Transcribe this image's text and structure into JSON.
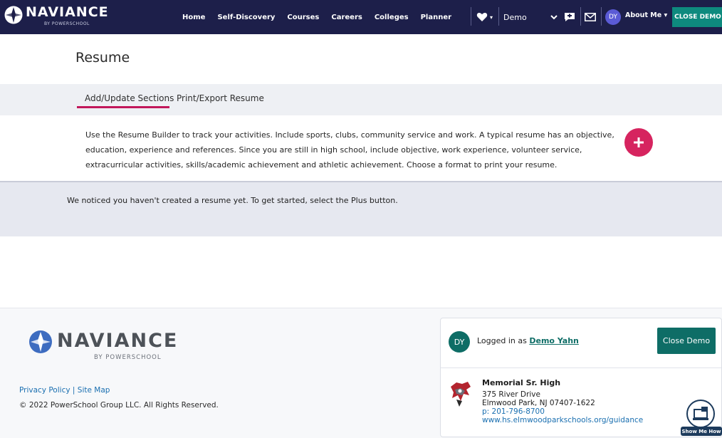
{
  "brand": {
    "name": "NAVIANCE",
    "sub": "BY POWERSCHOOL",
    "accent": "#1d1f4a",
    "pink": "#d6245f",
    "teal": "#0e6d66"
  },
  "nav": {
    "links": [
      "Home",
      "Self-Discovery",
      "Courses",
      "Careers",
      "Colleges",
      "Planner"
    ],
    "heart_icon": "heart-icon",
    "demo_select_value": "Demo",
    "avatar_initials": "DY",
    "about_me": "About Me ▾",
    "close_demo": "CLOSE DEMO"
  },
  "page": {
    "title": "Resume",
    "tabs": [
      "Add/Update Sections",
      "Print/Export Resume"
    ],
    "active_tab": 0,
    "intro": "Use the Resume Builder to track your activities. Include sports, clubs, community service and work. A typical resume has an objective, education, experience and references. Since you are still in high school, include objective, work experience, volunteer service, extracurricular activities, skills/academic achievement and athletic achievement. Choose a format to print your resume.",
    "notice": "We noticed you haven't created a resume yet. To get started, select the Plus button."
  },
  "footer": {
    "logo_word": "NAVIANCE",
    "logo_sub": "BY POWERSCHOOL",
    "privacy": "Privacy Policy",
    "sep": "|",
    "sitemap": "Site Map",
    "copyright": "© 2022 PowerSchool Group LLC. All Rights Reserved.",
    "card": {
      "initials": "DY",
      "logged_prefix": "Logged in as ",
      "logged_name": "Demo Yahn",
      "close_button": "Close Demo",
      "school_name": "Memorial Sr. High",
      "address1": "375 River Drive",
      "address2": "Elmwood Park, NJ 07407-1622",
      "phone": "p: 201-796-8700",
      "website": "www.hs.elmwoodparkschools.org/guidance"
    },
    "show_me_how": "Show Me How"
  }
}
